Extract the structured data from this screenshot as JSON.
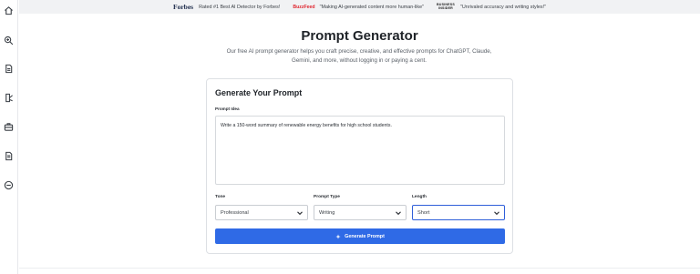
{
  "sidebar": {
    "icons": [
      "home-icon",
      "search-zoom-icon",
      "document-icon",
      "document-edit-icon",
      "briefcase-icon",
      "file-list-icon",
      "minus-circle-icon"
    ]
  },
  "banner": {
    "forbes_brand": "Forbes",
    "forbes_text": "Rated #1 Best AI Detector by Forbes!",
    "buzzfeed_brand": "BuzzFeed",
    "buzzfeed_text": "\"Making AI-generated content more human-like\"",
    "bi_brand_line1": "BUSINESS",
    "bi_brand_line2": "INSIDER",
    "bi_text": "\"Unrivaled accuracy and writing styles!\""
  },
  "page": {
    "title": "Prompt Generator",
    "subtitle": "Our free AI prompt generator helps you craft precise, creative, and effective prompts for ChatGPT, Claude, Gemini, and more, without logging in or paying a cent."
  },
  "form": {
    "heading": "Generate Your Prompt",
    "idea_label": "Prompt Idea",
    "idea_value": "Write a 150-word summary of renewable energy benefits for high school students.",
    "tone_label": "Tone",
    "tone_value": "Professional",
    "type_label": "Prompt Type",
    "type_value": "Writing",
    "length_label": "Length",
    "length_value": "Short",
    "button_label": "Generate Prompt"
  },
  "colors": {
    "accent": "#2f6ae6",
    "focus_border": "#2f5fd9",
    "buzzfeed_red": "#e0262f"
  }
}
